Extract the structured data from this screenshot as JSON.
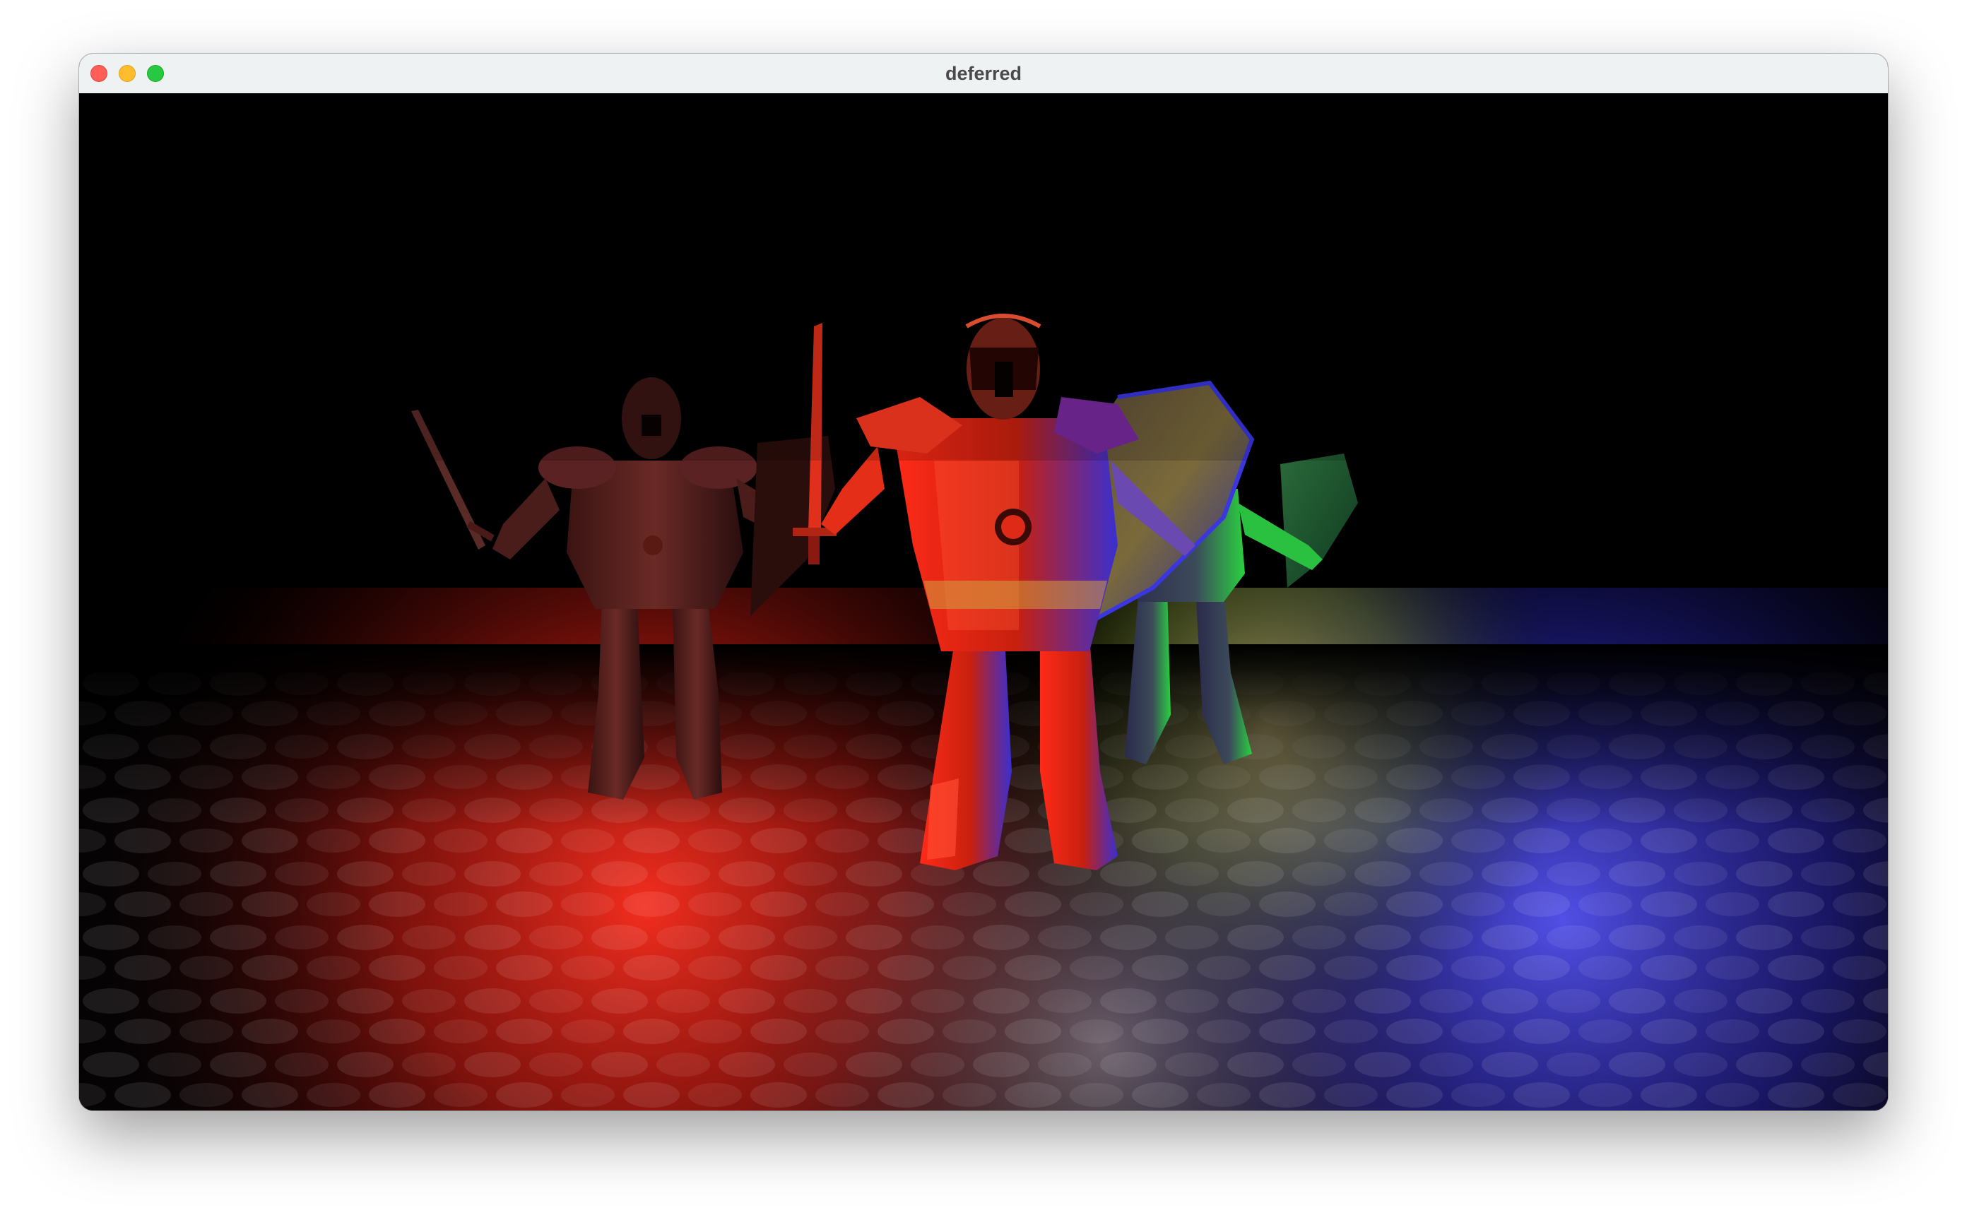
{
  "window": {
    "title": "deferred"
  },
  "viewport": {
    "scene": "deferred-shading-demo",
    "models": [
      "armored-knight",
      "armored-knight",
      "armored-knight"
    ],
    "light_colors": {
      "red": "#ff2a1e",
      "blue": "#3a3cff",
      "green": "#2cff3a",
      "yellow": "#e0d060"
    },
    "floor": "cobblestone"
  },
  "icons": {
    "close": "close-traffic-light-icon",
    "minimize": "minimize-traffic-light-icon",
    "zoom": "zoom-traffic-light-icon"
  }
}
